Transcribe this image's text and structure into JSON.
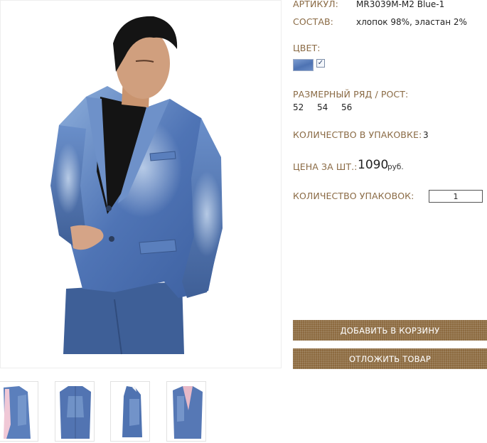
{
  "product": {
    "article_label": "АРТИКУЛ:",
    "article_value": "MR3039M-M2 Blue-1",
    "composition_label": "СОСТАВ:",
    "composition_value": "хлопок 98%, эластан 2%",
    "color_label": "ЦВЕТ:",
    "color_swatch": "#5878b6",
    "color_selected": "✓",
    "sizes_label": "РАЗМЕРНЫЙ РЯД / РОСТ:",
    "sizes": [
      "52",
      "54",
      "56"
    ],
    "pack_qty_label": "КОЛИЧЕСТВО В УПАКОВКЕ:",
    "pack_qty_value": "3",
    "price_label": "ЦЕНА ЗА ШТ.:",
    "price_value": "1090",
    "price_unit": "руб.",
    "packs_label": "КОЛИЧЕСТВО УПАКОВОК:",
    "packs_value": "1"
  },
  "actions": {
    "add_to_cart": "ДОБАВИТЬ В КОРЗИНУ",
    "postpone": "ОТЛОЖИТЬ ТОВАР"
  },
  "colors": {
    "label": "#8a6a44",
    "button": "#8c6a3f",
    "denim": "#4e73b3"
  },
  "gallery": {
    "thumbnail_icons": [
      "jacket-front-thumbnail",
      "jacket-back-thumbnail",
      "jacket-side-thumbnail",
      "jacket-model-thumbnail"
    ]
  }
}
